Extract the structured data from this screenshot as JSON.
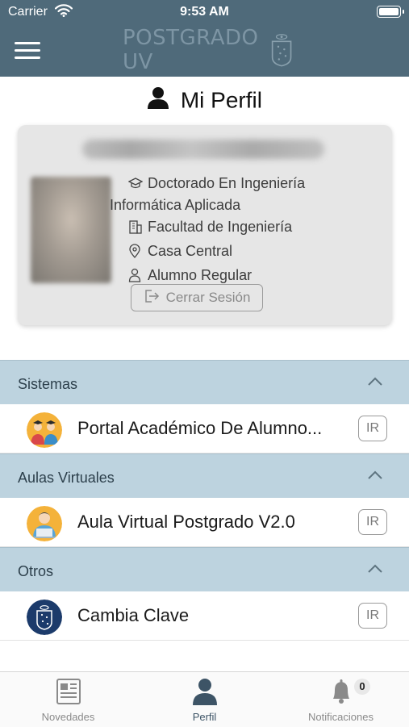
{
  "status_bar": {
    "carrier": "Carrier",
    "time": "9:53 AM"
  },
  "nav": {
    "logo_text": "POSTGRADO UV"
  },
  "profile": {
    "title": "Mi Perfil",
    "program_line1": "Doctorado En Ingeniería",
    "program_line2": "Informática Aplicada",
    "faculty": "Facultad de Ingeniería",
    "campus": "Casa Central",
    "status": "Alumno Regular",
    "logout_label": "Cerrar Sesión"
  },
  "sections": [
    {
      "header": "Sistemas",
      "item": {
        "name": "Portal Académico De Alumno...",
        "action": "IR"
      }
    },
    {
      "header": "Aulas Virtuales",
      "item": {
        "name": "Aula Virtual Postgrado V2.0",
        "action": "IR"
      }
    },
    {
      "header": "Otros",
      "item": {
        "name": "Cambia Clave",
        "action": "IR"
      }
    }
  ],
  "tabs": [
    {
      "label": "Novedades",
      "icon": "newspaper-icon"
    },
    {
      "label": "Perfil",
      "icon": "user-icon",
      "active": true
    },
    {
      "label": "Notificaciones",
      "icon": "bell-icon",
      "badge": "0"
    }
  ],
  "colors": {
    "header_bg": "#4f6a7a",
    "section_bg": "#bdd3df",
    "accent": "#3d5466"
  }
}
